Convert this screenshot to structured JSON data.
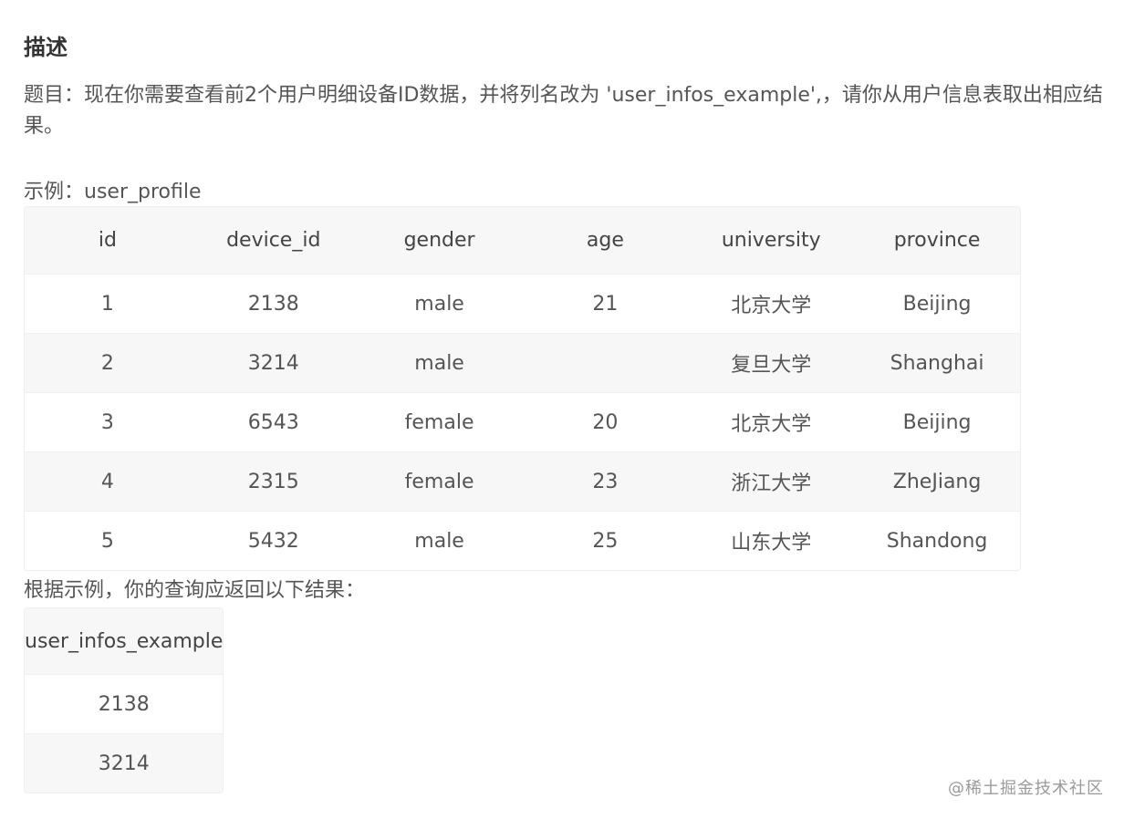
{
  "heading": "描述",
  "description": "题目：现在你需要查看前2个用户明细设备ID数据，并将列名改为 'user_infos_example',，请你从用户信息表取出相应结果。",
  "example_label": "示例：user_profile",
  "profile_table": {
    "headers": [
      "id",
      "device_id",
      "gender",
      "age",
      "university",
      "province"
    ],
    "rows": [
      [
        "1",
        "2138",
        "male",
        "21",
        "北京大学",
        "Beijing"
      ],
      [
        "2",
        "3214",
        "male",
        "",
        "复旦大学",
        "Shanghai"
      ],
      [
        "3",
        "6543",
        "female",
        "20",
        "北京大学",
        "Beijing"
      ],
      [
        "4",
        "2315",
        "female",
        "23",
        "浙江大学",
        "ZheJiang"
      ],
      [
        "5",
        "5432",
        "male",
        "25",
        "山东大学",
        "Shandong"
      ]
    ]
  },
  "result_label": "根据示例，你的查询应返回以下结果：",
  "result_table": {
    "headers": [
      "user_infos_example"
    ],
    "rows": [
      [
        "2138"
      ],
      [
        "3214"
      ]
    ]
  },
  "watermark": "@稀土掘金技术社区"
}
